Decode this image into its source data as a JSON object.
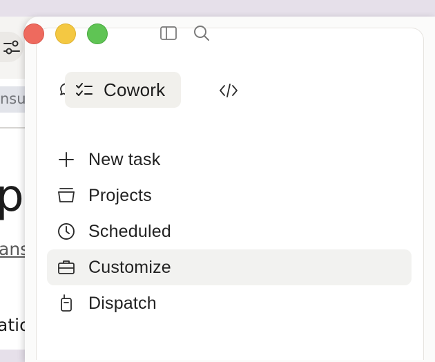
{
  "background_window": {
    "tab_text": "nsu",
    "big_text": "p",
    "link_text": "ans",
    "bottom_text": "atio"
  },
  "titlebar": {
    "traffic_lights": {
      "close": "#ee6a5e",
      "minimize": "#f4c842",
      "zoom": "#5fc454"
    },
    "icons": [
      "sidebar-toggle-icon",
      "search-icon"
    ]
  },
  "modes": {
    "chat_icon": "chat-bubbles-icon",
    "active": {
      "label": "Cowork",
      "icon": "checklist-icon"
    },
    "code_icon": "code-icon"
  },
  "menu": {
    "items": [
      {
        "label": "New task",
        "icon": "plus-icon"
      },
      {
        "label": "Projects",
        "icon": "folder-icon"
      },
      {
        "label": "Scheduled",
        "icon": "clock-icon"
      },
      {
        "label": "Customize",
        "icon": "briefcase-icon",
        "active": true
      },
      {
        "label": "Dispatch",
        "icon": "walkie-talkie-icon"
      }
    ]
  },
  "colors": {
    "active_bg": "#f2f2f0",
    "text": "#222222"
  }
}
